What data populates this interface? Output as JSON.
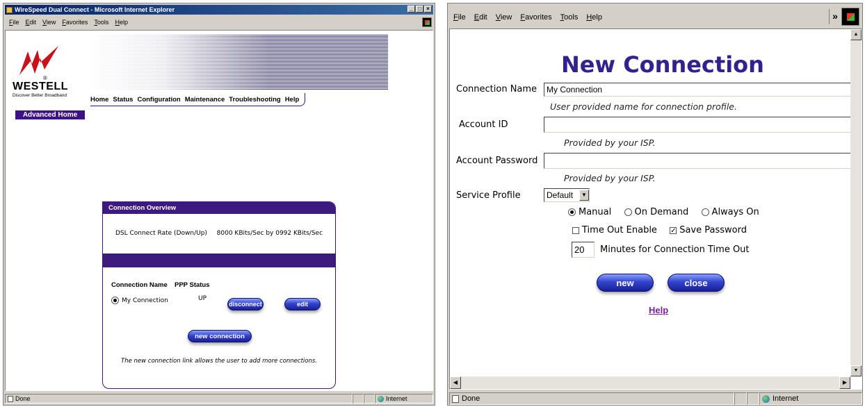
{
  "left_window": {
    "title": "WireSpeed Dual Connect - Microsoft Internet Explorer",
    "controls": [
      "_",
      "□",
      "×"
    ],
    "menu": [
      "File",
      "Edit",
      "View",
      "Favorites",
      "Tools",
      "Help"
    ],
    "brand": {
      "name": "WESTELL",
      "tagline": "Discover Better Broadband",
      "reg": "®"
    },
    "nav": [
      "Home",
      "Status",
      "Configuration",
      "Maintenance",
      "Troubleshooting",
      "Help"
    ],
    "advanced_home": "Advanced Home",
    "panel": {
      "header": "Connection Overview",
      "dsl_label": "DSL Connect Rate (Down/Up)",
      "dsl_value": "8000 KBits/Sec by 0992 KBits/Sec",
      "col_name": "Connection Name",
      "col_status": "PPP Status",
      "connection_name": "My Connection",
      "connection_status": "UP",
      "disconnect_btn": "disconnect",
      "edit_btn": "edit",
      "new_connection_btn": "new connection",
      "footnote": "The new connection link allows the user to add more connections."
    },
    "status": {
      "text": "Done",
      "zone": "Internet"
    }
  },
  "right_window": {
    "menu": [
      "File",
      "Edit",
      "View",
      "Favorites",
      "Tools",
      "Help"
    ],
    "chevron": "»",
    "heading": "New Connection",
    "connection_name_label": "Connection Name",
    "connection_name_value": "My Connection",
    "connection_name_hint": "User provided name for connection profile.",
    "account_id_label": "Account ID",
    "account_id_value": "",
    "account_id_hint": "Provided by your ISP.",
    "account_password_label": "Account Password",
    "account_password_value": "",
    "account_password_hint": "Provided by your ISP.",
    "service_profile_label": "Service Profile",
    "service_profile_value": "Default",
    "radio_manual": "Manual",
    "radio_on_demand": "On Demand",
    "radio_always_on": "Always On",
    "radio_selected": "Manual",
    "timeout_enable_label": "Time Out Enable",
    "timeout_enable_checked": false,
    "save_password_label": "Save Password",
    "save_password_checked": true,
    "timeout_minutes_value": "20",
    "timeout_minutes_label": "Minutes for Connection Time Out",
    "new_btn": "new",
    "close_btn": "close",
    "help_link": "Help",
    "status": {
      "text": "Done",
      "zone": "Internet"
    }
  },
  "colors": {
    "purple": "#3d1283",
    "panel_purple": "#3c1a7e",
    "heading": "#33218f",
    "link": "#7b1f9a"
  }
}
